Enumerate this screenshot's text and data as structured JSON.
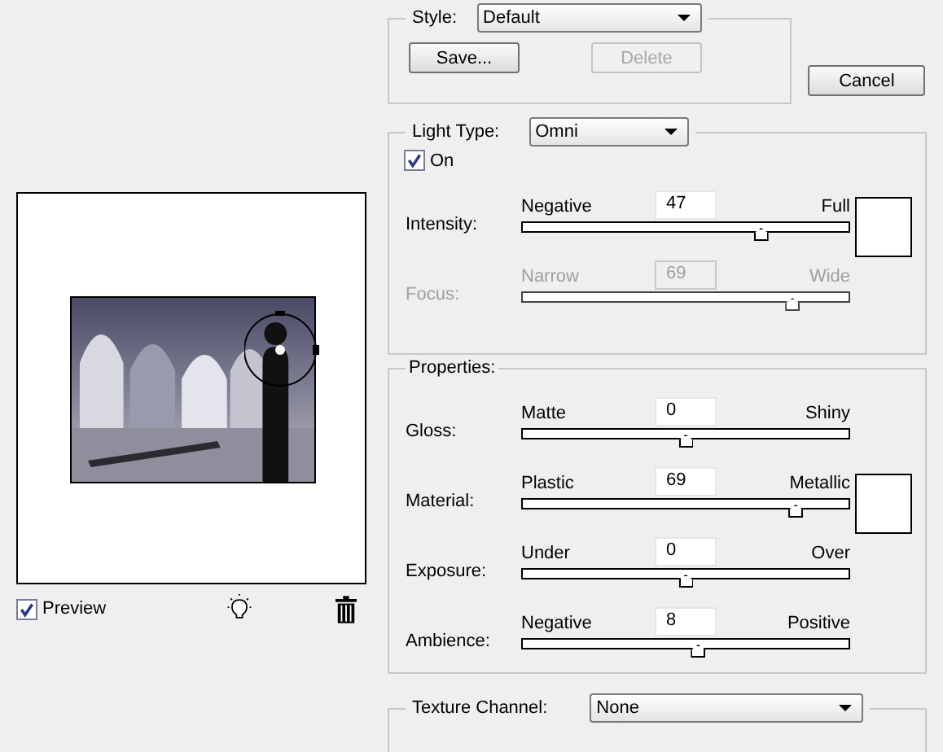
{
  "style": {
    "label": "Style:",
    "value": "Default"
  },
  "style_buttons": [
    {
      "label": "Save...",
      "disabled": false
    },
    {
      "label": "Delete",
      "disabled": true
    }
  ],
  "cancel_button": "Cancel",
  "light": {
    "label": "Light Type:",
    "value": "Omni",
    "on": {
      "label": "On",
      "checked": true
    },
    "sliders": [
      {
        "label": "Intensity:",
        "left": "Negative",
        "right": "Full",
        "value": "47",
        "level": 0.74,
        "disabled": false,
        "swatch": true
      },
      {
        "label": "Focus:",
        "left": "Narrow",
        "right": "Wide",
        "value": "69",
        "level": 0.84,
        "disabled": true,
        "swatch": false
      }
    ]
  },
  "properties": {
    "title": "Properties:",
    "sliders": [
      {
        "label": "Gloss:",
        "left": "Matte",
        "right": "Shiny",
        "value": "0",
        "level": 0.5,
        "disabled": false,
        "swatch": false
      },
      {
        "label": "Material:",
        "left": "Plastic",
        "right": "Metallic",
        "value": "69",
        "level": 0.85,
        "disabled": false,
        "swatch": true
      },
      {
        "label": "Exposure:",
        "left": "Under",
        "right": "Over",
        "value": "0",
        "level": 0.5,
        "disabled": false,
        "swatch": false
      },
      {
        "label": "Ambience:",
        "left": "Negative",
        "right": "Positive",
        "value": "8",
        "level": 0.54,
        "disabled": false,
        "swatch": false
      }
    ]
  },
  "texture": {
    "label": "Texture Channel:",
    "value": "None"
  },
  "preview": {
    "label": "Preview",
    "checked": true
  }
}
